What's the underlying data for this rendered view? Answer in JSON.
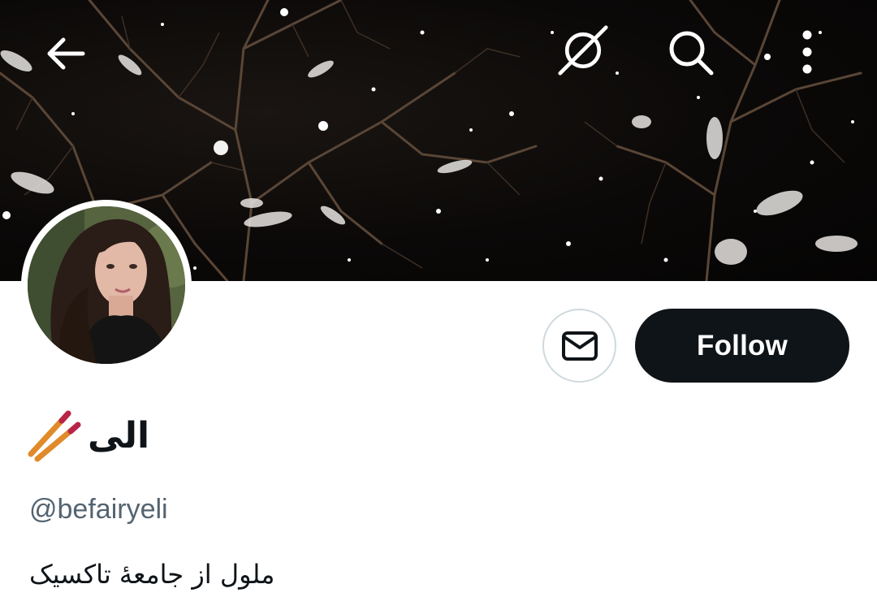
{
  "header": {
    "back_icon": "arrow-left-icon",
    "grok_icon": "grok-icon",
    "search_icon": "search-icon",
    "more_icon": "more-vertical-icon"
  },
  "profile": {
    "display_name": "الی",
    "name_emoji": "chopsticks-emoji",
    "handle": "@befairyeli",
    "bio": "ملول از جامعهٔ تاکسیک"
  },
  "actions": {
    "message_icon": "envelope-icon",
    "follow_label": "Follow"
  },
  "colors": {
    "follow_bg": "#0f1419",
    "follow_text": "#ffffff",
    "handle_text": "#536471",
    "banner_bg": "#0b0908"
  }
}
